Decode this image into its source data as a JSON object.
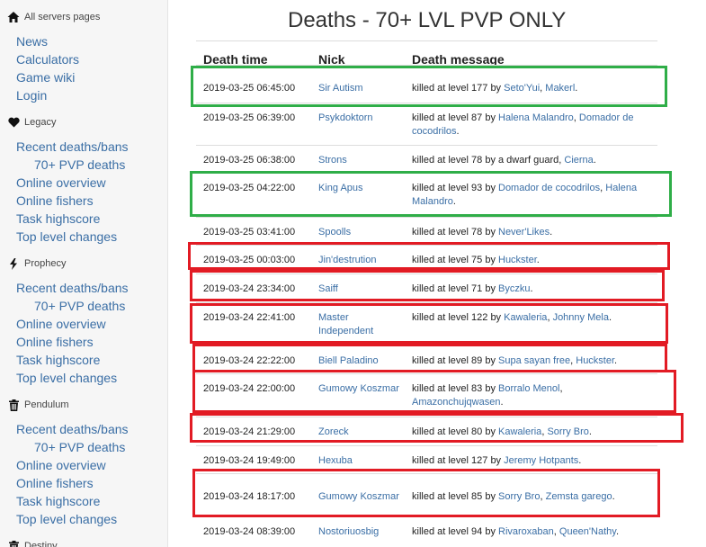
{
  "sidebar": {
    "header_all": "All servers pages",
    "all_links": [
      "News",
      "Calculators",
      "Game wiki",
      "Login"
    ],
    "sections": [
      {
        "name": "Legacy",
        "links": [
          "Recent deaths/bans",
          "70+ PVP deaths",
          "Online overview",
          "Online fishers",
          "Task highscore",
          "Top level changes"
        ]
      },
      {
        "name": "Prophecy",
        "links": [
          "Recent deaths/bans",
          "70+ PVP deaths",
          "Online overview",
          "Online fishers",
          "Task highscore",
          "Top level changes"
        ]
      },
      {
        "name": "Pendulum",
        "links": [
          "Recent deaths/bans",
          "70+ PVP deaths",
          "Online overview",
          "Online fishers",
          "Task highscore",
          "Top level changes"
        ]
      },
      {
        "name": "Destiny",
        "links": []
      }
    ]
  },
  "page": {
    "title": "Deaths - 70+ LVL PVP ONLY",
    "columns": {
      "time": "Death time",
      "nick": "Nick",
      "message": "Death message"
    }
  },
  "rows": [
    {
      "time": "2019-03-25 06:45:00",
      "nick": "Sir Autism",
      "prefix": "killed at level 177 by ",
      "killers": [
        "Seto'Yui",
        "Makerl"
      ],
      "mark": "green"
    },
    {
      "time": "2019-03-25 06:39:00",
      "nick": "Psykdoktorn",
      "prefix": "killed at level 87 by ",
      "killers": [
        "Halena Malandro",
        "Domador de cocodrilos"
      ],
      "mark": ""
    },
    {
      "time": "2019-03-25 06:38:00",
      "nick": "Strons",
      "prefix": "killed at level 78 by a dwarf guard, ",
      "killers": [
        "Cierna"
      ],
      "mark": ""
    },
    {
      "time": "2019-03-25 04:22:00",
      "nick": "King Apus",
      "prefix": "killed at level 93 by ",
      "killers": [
        "Domador de cocodrilos",
        "Halena Malandro"
      ],
      "mark": "green"
    },
    {
      "time": "2019-03-25 03:41:00",
      "nick": "Spoolls",
      "prefix": "killed at level 78 by ",
      "killers": [
        "Never'Likes"
      ],
      "mark": ""
    },
    {
      "time": "2019-03-25 00:03:00",
      "nick": "Jin'destrution",
      "prefix": "killed at level 75 by ",
      "killers": [
        "Huckster"
      ],
      "mark": "red"
    },
    {
      "time": "2019-03-24 23:34:00",
      "nick": "Saiff",
      "prefix": "killed at level 71 by ",
      "killers": [
        "Byczku"
      ],
      "mark": "red"
    },
    {
      "time": "2019-03-24 22:41:00",
      "nick": "Master Independent",
      "prefix": "killed at level 122 by ",
      "killers": [
        "Kawaleria",
        "Johnny Mela"
      ],
      "mark": "red"
    },
    {
      "time": "2019-03-24 22:22:00",
      "nick": "Biell Paladino",
      "prefix": "killed at level 89 by ",
      "killers": [
        "Supa sayan free",
        "Huckster"
      ],
      "mark": "red"
    },
    {
      "time": "2019-03-24 22:00:00",
      "nick": "Gumowy Koszmar",
      "prefix": "killed at level 83 by ",
      "killers": [
        "Borralo Menol",
        "Amazonchujqwasen"
      ],
      "mark": "red"
    },
    {
      "time": "2019-03-24 21:29:00",
      "nick": "Zoreck",
      "prefix": "killed at level 80 by ",
      "killers": [
        "Kawaleria",
        "Sorry Bro"
      ],
      "mark": "red"
    },
    {
      "time": "2019-03-24 19:49:00",
      "nick": "Hexuba",
      "prefix": "killed at level 127 by ",
      "killers": [
        "Jeremy Hotpants"
      ],
      "mark": ""
    },
    {
      "time": "2019-03-24 18:17:00",
      "nick": "Gumowy Koszmar",
      "prefix": "killed at level 85 by ",
      "killers": [
        "Sorry Bro",
        "Zemsta garego"
      ],
      "mark": "red"
    },
    {
      "time": "2019-03-24 08:39:00",
      "nick": "Nostoriuosbig",
      "prefix": "killed at level 94 by ",
      "killers": [
        "Rivaroxaban",
        "Queen'Nathy"
      ],
      "mark": ""
    }
  ],
  "colors": {
    "link": "#3a6ea5",
    "green_box": "#2fae48",
    "red_box": "#e21b24"
  },
  "icons": {
    "all": "home-icon",
    "Legacy": "heart-icon",
    "Prophecy": "bolt-icon",
    "Pendulum": "trash-icon",
    "Destiny": "trash-icon"
  }
}
